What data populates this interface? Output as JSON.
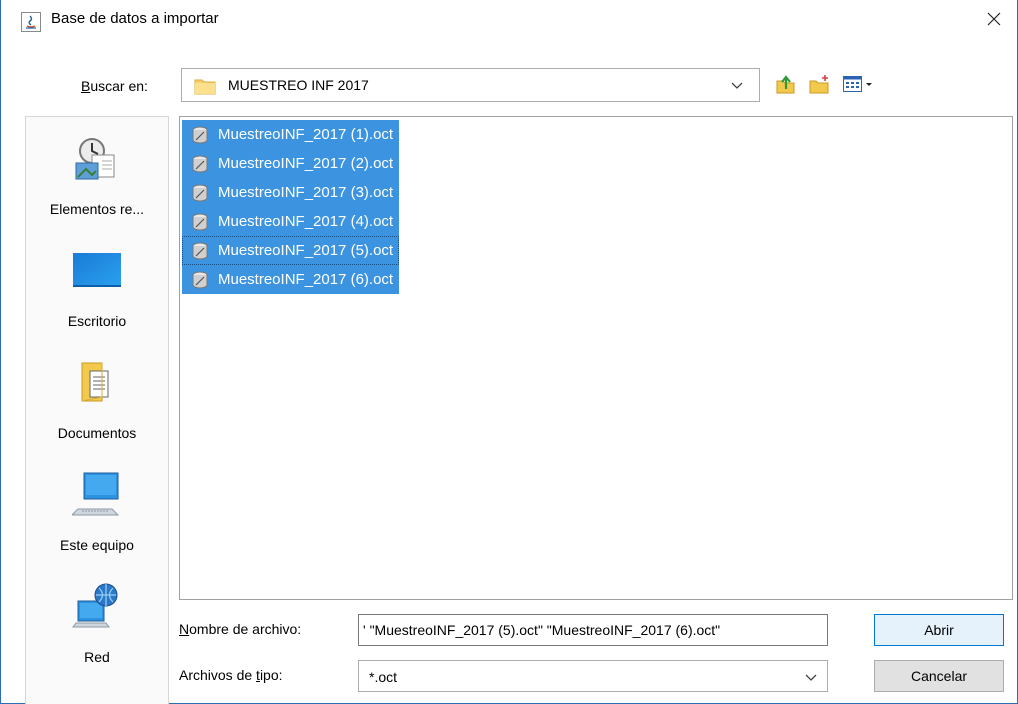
{
  "window": {
    "title": "Base de datos a importar"
  },
  "lookin": {
    "label": "Buscar en:",
    "label_mnemonic": "B",
    "label_rest": "uscar en:",
    "value": "MUESTREO INF 2017"
  },
  "toolbar": {
    "up_icon": "up-folder-icon",
    "new_folder_icon": "new-folder-icon",
    "view_menu_icon": "view-menu-icon"
  },
  "places": [
    {
      "label": "Elementos re...",
      "icon": "recent-items-icon"
    },
    {
      "label": "Escritorio",
      "icon": "desktop-icon"
    },
    {
      "label": "Documentos",
      "icon": "documents-icon"
    },
    {
      "label": "Este equipo",
      "icon": "computer-icon"
    },
    {
      "label": "Red",
      "icon": "network-icon"
    }
  ],
  "files": [
    "MuestreoINF_2017 (1).oct",
    "MuestreoINF_2017 (2).oct",
    "MuestreoINF_2017 (3).oct",
    "MuestreoINF_2017 (4).oct",
    "MuestreoINF_2017 (5).oct",
    "MuestreoINF_2017 (6).oct"
  ],
  "filename": {
    "label": "Nombre de archivo:",
    "label_mnemonic": "N",
    "label_rest": "ombre de archivo:",
    "value": "' \"MuestreoINF_2017 (5).oct\" \"MuestreoINF_2017 (6).oct\""
  },
  "filetype": {
    "label": "Archivos de tipo:",
    "label_pre": "Archivos de ",
    "label_mnemonic": "t",
    "label_post": "ipo:",
    "value": "*.oct"
  },
  "buttons": {
    "open": "Abrir",
    "cancel": "Cancelar"
  },
  "colors": {
    "selection": "#3c94e0",
    "selection_text": "#ffffff",
    "border_accent": "#2b6fb5",
    "default_button": "#e5f1fb"
  }
}
